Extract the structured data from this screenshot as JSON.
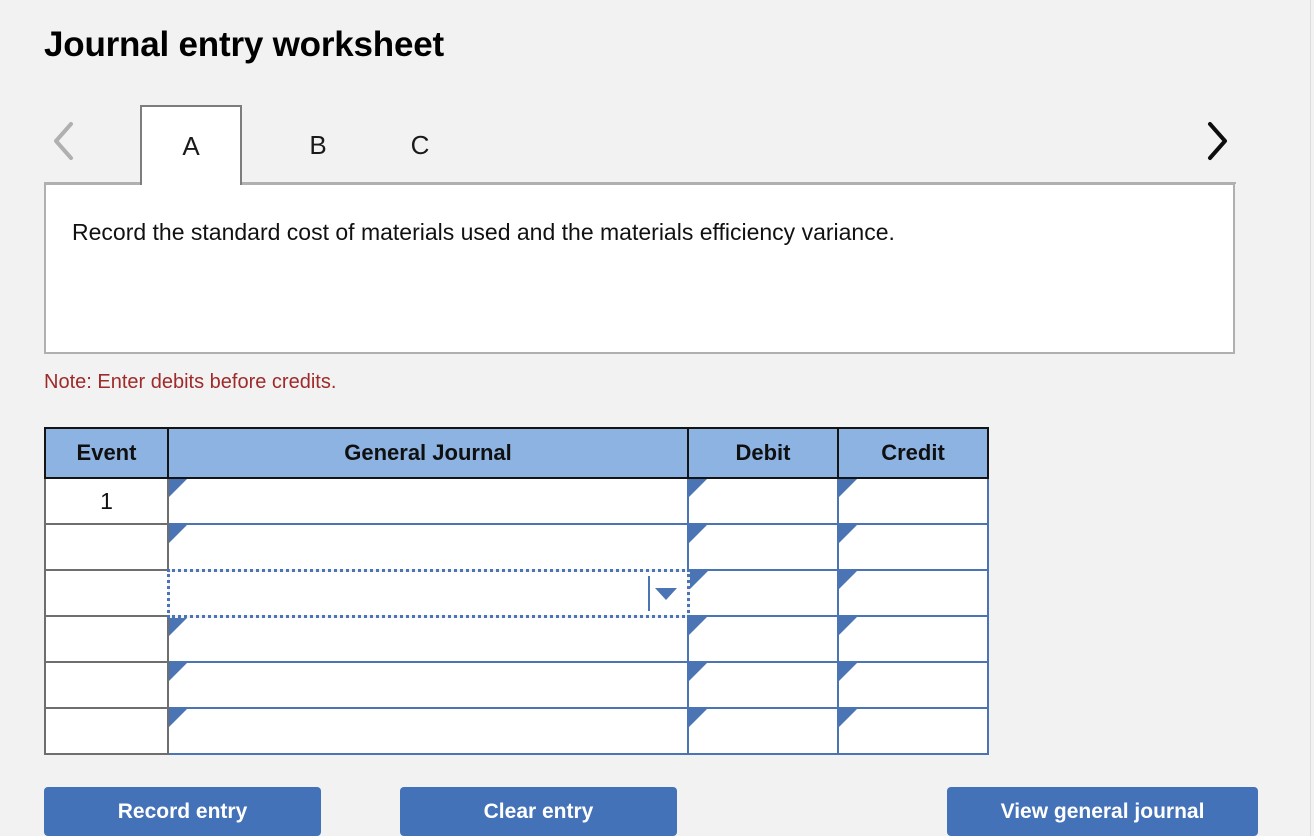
{
  "page": {
    "title": "Journal entry worksheet",
    "background_color": "#f2f2f2"
  },
  "tabs": {
    "prev_icon": "chevron-left-icon",
    "next_icon": "chevron-right-icon",
    "prev_enabled": false,
    "next_enabled": true,
    "items": [
      {
        "label": "A",
        "active": true
      },
      {
        "label": "B",
        "active": false
      },
      {
        "label": "C",
        "active": false
      }
    ]
  },
  "content": {
    "instruction": "Record the standard cost of materials used and the materials efficiency variance."
  },
  "note": {
    "text": "Note: Enter debits before credits.",
    "color": "#9e2a2a"
  },
  "journal": {
    "header_color": "#8cb3e2",
    "cell_border_color": "#4a74b4",
    "columns": [
      {
        "key": "event",
        "label": "Event"
      },
      {
        "key": "general_journal",
        "label": "General Journal"
      },
      {
        "key": "debit",
        "label": "Debit"
      },
      {
        "key": "credit",
        "label": "Credit"
      }
    ],
    "rows": [
      {
        "event": "1",
        "general_journal": "",
        "debit": "",
        "credit": "",
        "journal_is_dropdown": false
      },
      {
        "event": "",
        "general_journal": "",
        "debit": "",
        "credit": "",
        "journal_is_dropdown": false
      },
      {
        "event": "",
        "general_journal": "",
        "debit": "",
        "credit": "",
        "journal_is_dropdown": true
      },
      {
        "event": "",
        "general_journal": "",
        "debit": "",
        "credit": "",
        "journal_is_dropdown": false
      },
      {
        "event": "",
        "general_journal": "",
        "debit": "",
        "credit": "",
        "journal_is_dropdown": false
      },
      {
        "event": "",
        "general_journal": "",
        "debit": "",
        "credit": "",
        "journal_is_dropdown": false
      }
    ],
    "dropdown": {
      "selected_value": "",
      "caret_icon": "chevron-down-icon"
    }
  },
  "actions": {
    "record_label": "Record entry",
    "clear_label": "Clear entry",
    "view_label": "View general journal",
    "button_color": "#4472b8"
  }
}
